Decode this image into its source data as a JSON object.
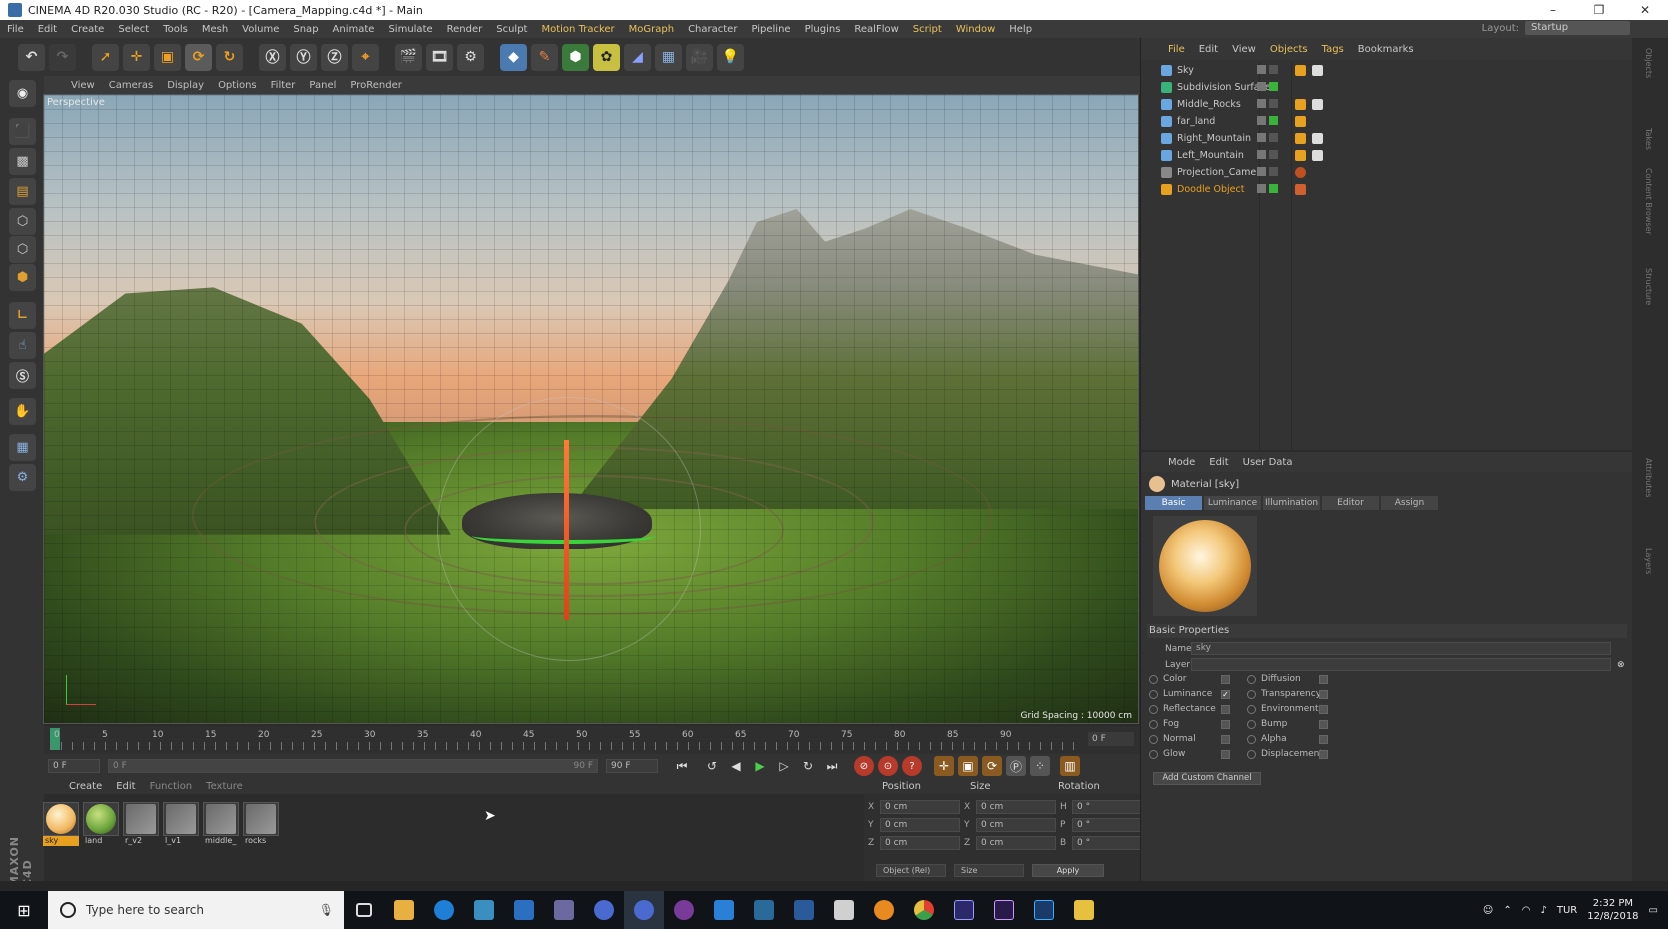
{
  "window": {
    "title": "CINEMA 4D R20.030 Studio (RC - R20) - [Camera_Mapping.c4d *] - Main",
    "controls": [
      "–",
      "❐",
      "✕"
    ]
  },
  "menubar": {
    "items": [
      "File",
      "Edit",
      "Create",
      "Select",
      "Tools",
      "Mesh",
      "Volume",
      "Snap",
      "Animate",
      "Simulate",
      "Render",
      "Sculpt",
      "Motion Tracker",
      "MoGraph",
      "Character",
      "Pipeline",
      "Plugins",
      "RealFlow",
      "Script",
      "Window",
      "Help"
    ],
    "layout_label": "Layout:",
    "layout_value": "Startup"
  },
  "viewport_menu": {
    "items": [
      "View",
      "Cameras",
      "Display",
      "Options",
      "Filter",
      "Panel",
      "ProRender"
    ],
    "camera_label": "Perspective",
    "grid_spacing": "Grid Spacing : 10000 cm"
  },
  "timeline": {
    "ticks": [
      "0",
      "5",
      "10",
      "15",
      "20",
      "25",
      "30",
      "35",
      "40",
      "45",
      "50",
      "55",
      "60",
      "65",
      "70",
      "75",
      "80",
      "85",
      "90"
    ],
    "end_frame": "0 F"
  },
  "transport": {
    "current_frame": "0 F",
    "range_start": "0 F",
    "range_end": "90 F",
    "max_frame": "90 F"
  },
  "material_manager": {
    "menu": [
      "Create",
      "Edit",
      "Function",
      "Texture"
    ],
    "materials": [
      {
        "name": "sky",
        "color": "#f0c070"
      },
      {
        "name": "land",
        "color": "#6aa33a"
      },
      {
        "name": "r_v2",
        "color": "#7a7a7a"
      },
      {
        "name": "l_v1",
        "color": "#7a7a7a"
      },
      {
        "name": "middle_",
        "color": "#7a7a7a"
      },
      {
        "name": "rocks",
        "color": "#7a7a7a"
      }
    ]
  },
  "coordinates": {
    "headers": [
      "Position",
      "Size",
      "Rotation"
    ],
    "rows": [
      {
        "a1": "X",
        "p": "0 cm",
        "a2": "X",
        "s": "0 cm",
        "a3": "H",
        "r": "0 °"
      },
      {
        "a1": "Y",
        "p": "0 cm",
        "a2": "Y",
        "s": "0 cm",
        "a3": "P",
        "r": "0 °"
      },
      {
        "a1": "Z",
        "p": "0 cm",
        "a2": "Z",
        "s": "0 cm",
        "a3": "B",
        "r": "0 °"
      }
    ],
    "mode": "Object (Rel)",
    "size_mode": "Size",
    "apply": "Apply"
  },
  "object_manager": {
    "menu": [
      "File",
      "Edit",
      "View",
      "Objects",
      "Tags",
      "Bookmarks"
    ],
    "objects": [
      {
        "name": "Sky",
        "icon_color": "#6aa7e0"
      },
      {
        "name": "Subdivision Surface",
        "icon_color": "#3ab37a"
      },
      {
        "name": "Middle_Rocks",
        "icon_color": "#6aa7e0"
      },
      {
        "name": "far_land",
        "icon_color": "#6aa7e0"
      },
      {
        "name": "Right_Mountain",
        "icon_color": "#6aa7e0"
      },
      {
        "name": "Left_Mountain",
        "icon_color": "#6aa7e0"
      },
      {
        "name": "Projection_Camera",
        "icon_color": "#888888"
      },
      {
        "name": "Doodle Object",
        "icon_color": "#e8a020"
      }
    ]
  },
  "attribute_manager": {
    "menu": [
      "Mode",
      "Edit",
      "User Data"
    ],
    "title": "Material [sky]",
    "tabs": [
      "Basic",
      "Luminance",
      "Illumination",
      "Editor",
      "Assign"
    ],
    "section": "Basic Properties",
    "name_label": "Name",
    "name_value": "sky",
    "layer_label": "Layer",
    "channels_left": [
      {
        "name": "Color",
        "checked": ""
      },
      {
        "name": "Luminance",
        "checked": "✓"
      },
      {
        "name": "Reflectance",
        "checked": ""
      },
      {
        "name": "Fog",
        "checked": ""
      },
      {
        "name": "Normal",
        "checked": ""
      },
      {
        "name": "Glow",
        "checked": ""
      }
    ],
    "channels_right": [
      {
        "name": "Diffusion",
        "checked": ""
      },
      {
        "name": "Transparency",
        "checked": ""
      },
      {
        "name": "Environment",
        "checked": ""
      },
      {
        "name": "Bump",
        "checked": ""
      },
      {
        "name": "Alpha",
        "checked": ""
      },
      {
        "name": "Displacement",
        "checked": ""
      }
    ],
    "add_channel": "Add Custom Channel"
  },
  "taskbar": {
    "search_placeholder": "Type here to search",
    "apps": [
      "#5c6bc0",
      "#e8b040",
      "#1f7fd6",
      "#3a8fc0",
      "#2a6fc0",
      "#6a6aa0",
      "#4a6ad0",
      "#4a6ad0",
      "#7a3a9a",
      "#2a7fd6",
      "#2a6a9a",
      "#2a5a9a",
      "#d0d0d0",
      "#e88a20",
      "#3aa04a",
      "#2a2a6a",
      "#2a1a4a",
      "#1a3a6a",
      "#e8c040"
    ],
    "language": "TUR",
    "time": "2:32 PM",
    "date": "12/8/2018"
  }
}
